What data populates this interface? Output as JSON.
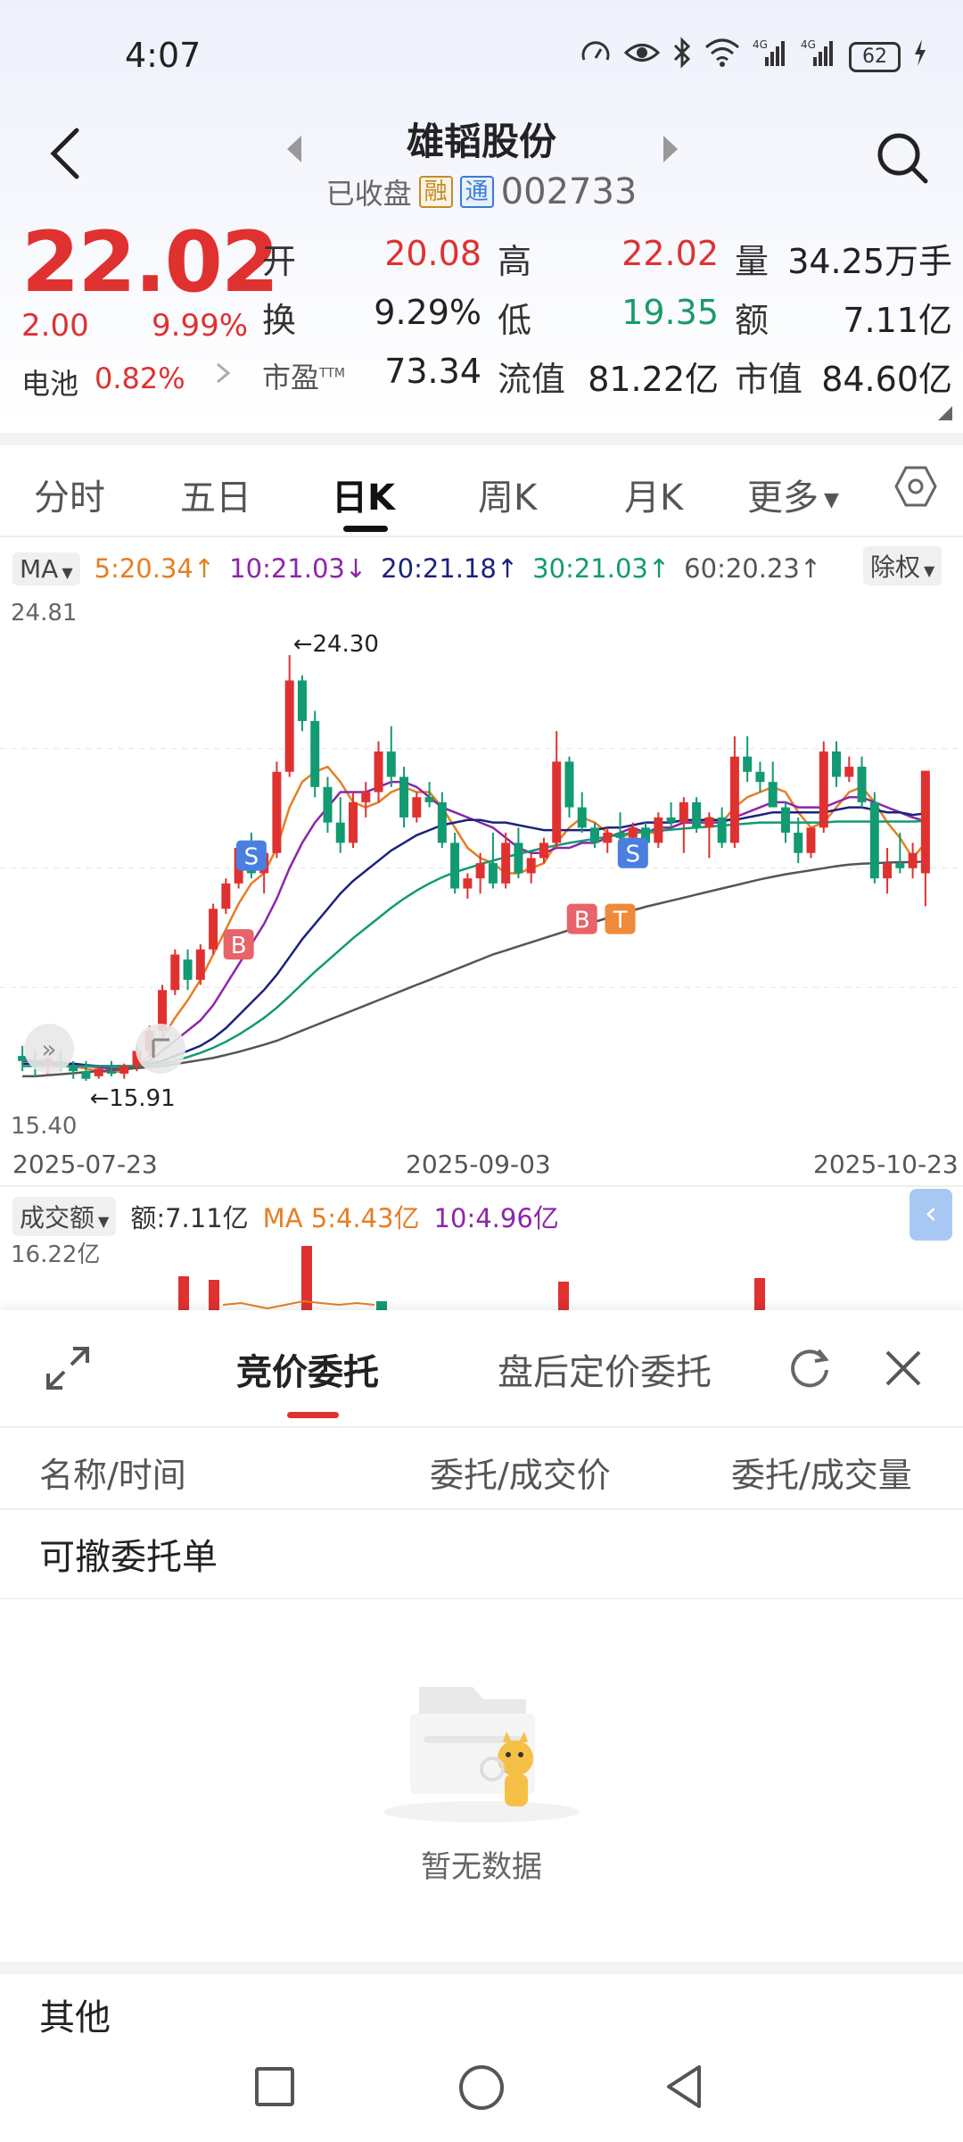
{
  "status_bar": {
    "time": "4:07",
    "network": "4G",
    "battery": "62"
  },
  "header": {
    "title": "雄韬股份",
    "market_status": "已收盘",
    "tag_margin": "融",
    "tag_connect": "通",
    "code": "002733"
  },
  "quote": {
    "price": "22.02",
    "change": "2.00",
    "change_pct": "9.99%",
    "sector_label": "电池",
    "sector_pct": "0.82%",
    "fields": [
      {
        "label": "开",
        "value": "20.08",
        "color": "#e03131"
      },
      {
        "label": "高",
        "value": "22.02",
        "color": "#e03131"
      },
      {
        "label": "量",
        "value": "34.25万手",
        "color": "#222222"
      },
      {
        "label": "换",
        "value": "9.29%",
        "color": "#222222"
      },
      {
        "label": "低",
        "value": "19.35",
        "color": "#1a9a6a"
      },
      {
        "label": "额",
        "value": "7.11亿",
        "color": "#222222"
      },
      {
        "label": "市盈",
        "sup": "TTM",
        "value": "73.34",
        "color": "#222222"
      },
      {
        "label": "流值",
        "value": "81.22亿",
        "color": "#222222"
      },
      {
        "label": "市值",
        "value": "84.60亿",
        "color": "#222222"
      }
    ]
  },
  "period_tabs": [
    "分时",
    "五日",
    "日K",
    "周K",
    "月K",
    "更多"
  ],
  "active_period": "日K",
  "ma_bar": {
    "button": "MA",
    "items": [
      {
        "text": "5:20.34↑",
        "color": "#e67e22"
      },
      {
        "text": "10:21.03↓",
        "color": "#8e24aa"
      },
      {
        "text": "20:21.18↑",
        "color": "#1a237e"
      },
      {
        "text": "30:21.03↑",
        "color": "#129a72"
      },
      {
        "text": "60:20.23↑",
        "color": "#555555"
      }
    ],
    "adjust": "除权"
  },
  "chart_data": {
    "type": "candlestick",
    "y_max_label": "24.81",
    "y_min_label": "15.40",
    "ylim": [
      15.4,
      24.81
    ],
    "x_labels": [
      "2025-07-23",
      "2025-09-03",
      "2025-10-23"
    ],
    "high_mark": "←24.30",
    "low_mark": "←15.91",
    "signals": [
      "B",
      "S",
      "B",
      "T",
      "S"
    ],
    "candles": [
      [
        16.4,
        16.6,
        16.1,
        16.3
      ],
      [
        16.3,
        16.5,
        16.0,
        16.2
      ],
      [
        16.2,
        16.4,
        16.0,
        16.35
      ],
      [
        16.3,
        16.5,
        16.1,
        16.2
      ],
      [
        16.2,
        16.3,
        15.95,
        16.1
      ],
      [
        16.1,
        16.3,
        15.91,
        15.95
      ],
      [
        16.0,
        16.2,
        15.95,
        16.15
      ],
      [
        16.1,
        16.3,
        16.0,
        16.05
      ],
      [
        16.05,
        16.25,
        15.95,
        16.2
      ],
      [
        16.2,
        16.6,
        16.1,
        16.5
      ],
      [
        16.5,
        17.0,
        16.4,
        16.9
      ],
      [
        16.9,
        17.8,
        16.8,
        17.7
      ],
      [
        17.7,
        18.5,
        17.6,
        18.4
      ],
      [
        18.3,
        18.5,
        17.7,
        17.9
      ],
      [
        17.9,
        18.6,
        17.8,
        18.5
      ],
      [
        18.5,
        19.4,
        18.4,
        19.3
      ],
      [
        19.3,
        19.9,
        19.2,
        19.8
      ],
      [
        19.8,
        20.6,
        19.7,
        20.5
      ],
      [
        20.5,
        20.8,
        19.9,
        20.0
      ],
      [
        20.0,
        20.6,
        19.6,
        20.4
      ],
      [
        20.4,
        22.2,
        20.3,
        22.0
      ],
      [
        22.0,
        24.3,
        21.9,
        23.8
      ],
      [
        23.8,
        23.9,
        22.8,
        23.0
      ],
      [
        23.0,
        23.2,
        21.5,
        21.7
      ],
      [
        21.7,
        21.9,
        20.8,
        21.0
      ],
      [
        21.0,
        21.5,
        20.4,
        20.6
      ],
      [
        20.6,
        21.6,
        20.5,
        21.4
      ],
      [
        21.4,
        21.8,
        21.1,
        21.6
      ],
      [
        21.6,
        22.6,
        21.4,
        22.4
      ],
      [
        22.4,
        22.9,
        21.7,
        21.9
      ],
      [
        21.9,
        22.1,
        20.9,
        21.1
      ],
      [
        21.1,
        21.6,
        21.0,
        21.5
      ],
      [
        21.5,
        21.8,
        21.3,
        21.4
      ],
      [
        21.4,
        21.6,
        20.5,
        20.6
      ],
      [
        20.6,
        20.8,
        19.6,
        19.7
      ],
      [
        19.7,
        20.0,
        19.5,
        19.9
      ],
      [
        19.9,
        20.4,
        19.6,
        20.2
      ],
      [
        20.2,
        20.8,
        19.7,
        19.8
      ],
      [
        19.8,
        20.8,
        19.7,
        20.6
      ],
      [
        20.6,
        20.9,
        19.9,
        20.0
      ],
      [
        20.0,
        20.4,
        19.8,
        20.3
      ],
      [
        20.3,
        20.7,
        20.2,
        20.6
      ],
      [
        20.6,
        22.8,
        20.5,
        22.2
      ],
      [
        22.2,
        22.3,
        21.1,
        21.3
      ],
      [
        21.3,
        21.6,
        20.8,
        20.9
      ],
      [
        20.9,
        21.0,
        20.5,
        20.6
      ],
      [
        20.6,
        20.9,
        20.4,
        20.8
      ],
      [
        20.8,
        21.2,
        20.6,
        20.7
      ],
      [
        20.7,
        21.0,
        20.6,
        20.9
      ],
      [
        20.9,
        21.0,
        20.5,
        20.6
      ],
      [
        20.6,
        21.2,
        20.5,
        21.1
      ],
      [
        21.1,
        21.4,
        20.9,
        21.0
      ],
      [
        21.0,
        21.5,
        20.4,
        21.4
      ],
      [
        21.4,
        21.5,
        20.8,
        20.9
      ],
      [
        20.9,
        21.2,
        20.3,
        21.1
      ],
      [
        21.1,
        21.3,
        20.5,
        20.6
      ],
      [
        20.6,
        22.7,
        20.5,
        22.3
      ],
      [
        22.3,
        22.7,
        21.8,
        22.0
      ],
      [
        22.0,
        22.2,
        21.6,
        21.8
      ],
      [
        21.8,
        22.2,
        21.5,
        21.3
      ],
      [
        21.3,
        21.4,
        20.6,
        20.8
      ],
      [
        20.8,
        21.1,
        20.2,
        20.4
      ],
      [
        20.4,
        20.9,
        20.3,
        20.9
      ],
      [
        20.9,
        22.6,
        20.8,
        22.4
      ],
      [
        22.4,
        22.6,
        21.7,
        21.9
      ],
      [
        21.9,
        22.3,
        21.8,
        22.1
      ],
      [
        22.1,
        22.3,
        21.3,
        21.4
      ],
      [
        21.4,
        21.6,
        19.8,
        19.9
      ],
      [
        19.9,
        20.5,
        19.6,
        20.2
      ],
      [
        20.2,
        20.8,
        20.0,
        20.1
      ],
      [
        20.1,
        20.6,
        19.9,
        20.4
      ],
      [
        20.0,
        22.02,
        19.35,
        22.02
      ]
    ],
    "ma_lines": [
      {
        "name": "MA5",
        "color": "#e67e22",
        "values": [
          16.35,
          16.3,
          16.25,
          16.2,
          16.2,
          16.15,
          16.1,
          16.08,
          16.1,
          16.2,
          16.4,
          16.75,
          17.15,
          17.5,
          17.9,
          18.4,
          18.9,
          19.4,
          19.8,
          20.0,
          20.5,
          21.3,
          21.8,
          22.0,
          22.1,
          21.8,
          21.4,
          21.3,
          21.4,
          21.6,
          21.7,
          21.6,
          21.6,
          21.3,
          20.9,
          20.5,
          20.3,
          20.2,
          20.0,
          20.0,
          20.1,
          20.2,
          20.6,
          20.9,
          21.1,
          21.0,
          20.8,
          20.7,
          20.8,
          20.8,
          20.8,
          20.9,
          21.0,
          21.0,
          21.1,
          21.0,
          21.3,
          21.5,
          21.6,
          21.7,
          21.6,
          21.2,
          20.9,
          21.0,
          21.3,
          21.6,
          21.7,
          21.4,
          21.0,
          20.7,
          20.3,
          20.6
        ]
      },
      {
        "name": "MA10",
        "color": "#8e24aa",
        "values": [
          16.3,
          16.3,
          16.3,
          16.25,
          16.22,
          16.2,
          16.18,
          16.15,
          16.15,
          16.2,
          16.3,
          16.5,
          16.7,
          16.9,
          17.1,
          17.4,
          17.8,
          18.2,
          18.6,
          19.0,
          19.5,
          20.1,
          20.6,
          21.0,
          21.3,
          21.6,
          21.6,
          21.6,
          21.7,
          21.8,
          21.8,
          21.7,
          21.5,
          21.3,
          21.2,
          21.1,
          21.0,
          20.9,
          20.7,
          20.5,
          20.4,
          20.4,
          20.5,
          20.5,
          20.6,
          20.6,
          20.7,
          20.8,
          20.9,
          20.8,
          20.9,
          20.9,
          21.0,
          21.0,
          21.0,
          21.0,
          21.1,
          21.2,
          21.3,
          21.4,
          21.4,
          21.3,
          21.3,
          21.3,
          21.4,
          21.5,
          21.5,
          21.4,
          21.3,
          21.2,
          21.1,
          21.03
        ]
      },
      {
        "name": "MA20",
        "color": "#1a237e",
        "values": [
          16.25,
          16.25,
          16.25,
          16.25,
          16.25,
          16.22,
          16.2,
          16.2,
          16.2,
          16.2,
          16.25,
          16.3,
          16.4,
          16.5,
          16.6,
          16.75,
          16.95,
          17.2,
          17.45,
          17.7,
          18.0,
          18.35,
          18.7,
          19.0,
          19.3,
          19.6,
          19.85,
          20.05,
          20.25,
          20.45,
          20.6,
          20.75,
          20.85,
          20.95,
          21.0,
          21.05,
          21.05,
          21.0,
          21.0,
          20.95,
          20.9,
          20.85,
          20.85,
          20.85,
          20.85,
          20.85,
          20.9,
          20.9,
          20.95,
          21.0,
          21.0,
          21.0,
          21.05,
          21.05,
          21.05,
          21.05,
          21.05,
          21.1,
          21.15,
          21.2,
          21.2,
          21.2,
          21.2,
          21.2,
          21.25,
          21.3,
          21.3,
          21.25,
          21.2,
          21.2,
          21.15,
          21.18
        ]
      },
      {
        "name": "MA30",
        "color": "#129a72",
        "values": [
          16.2,
          16.2,
          16.2,
          16.2,
          16.2,
          16.2,
          16.2,
          16.2,
          16.2,
          16.2,
          16.22,
          16.25,
          16.3,
          16.38,
          16.46,
          16.56,
          16.68,
          16.82,
          16.98,
          17.15,
          17.35,
          17.58,
          17.82,
          18.06,
          18.28,
          18.5,
          18.72,
          18.92,
          19.12,
          19.32,
          19.5,
          19.66,
          19.8,
          19.92,
          20.02,
          20.1,
          20.18,
          20.25,
          20.32,
          20.38,
          20.44,
          20.5,
          20.55,
          20.6,
          20.64,
          20.68,
          20.72,
          20.76,
          20.8,
          20.82,
          20.84,
          20.86,
          20.88,
          20.9,
          20.92,
          20.94,
          20.96,
          20.98,
          21.0,
          21.0,
          21.0,
          21.0,
          21.0,
          21.0,
          21.02,
          21.02,
          21.02,
          21.02,
          21.02,
          21.02,
          21.02,
          21.03
        ]
      },
      {
        "name": "MA60",
        "color": "#555555",
        "values": [
          16.0,
          16.0,
          16.02,
          16.04,
          16.06,
          16.08,
          16.1,
          16.12,
          16.14,
          16.16,
          16.18,
          16.2,
          16.24,
          16.28,
          16.32,
          16.36,
          16.42,
          16.48,
          16.55,
          16.62,
          16.7,
          16.8,
          16.9,
          17.0,
          17.1,
          17.2,
          17.3,
          17.4,
          17.5,
          17.6,
          17.7,
          17.8,
          17.9,
          18.0,
          18.1,
          18.2,
          18.3,
          18.4,
          18.48,
          18.56,
          18.64,
          18.72,
          18.8,
          18.88,
          18.96,
          19.04,
          19.12,
          19.2,
          19.27,
          19.34,
          19.4,
          19.46,
          19.52,
          19.58,
          19.64,
          19.7,
          19.76,
          19.82,
          19.88,
          19.93,
          19.98,
          20.02,
          20.06,
          20.1,
          20.14,
          20.17,
          20.19,
          20.2,
          20.21,
          20.22,
          20.22,
          20.23
        ]
      }
    ],
    "volume": {
      "label": "成交额",
      "amount": "额:7.11亿",
      "ma5": "MA 5:4.43亿",
      "ma10": "10:4.96亿",
      "max_label": "16.22亿"
    }
  },
  "order_panel": {
    "tabs": [
      "竞价委托",
      "盘后定价委托"
    ],
    "active_tab": "竞价委托",
    "columns": [
      "名称/时间",
      "委托/成交价",
      "委托/成交量"
    ],
    "section_title": "可撤委托单",
    "empty_text": "暂无数据",
    "other_title": "其他"
  }
}
